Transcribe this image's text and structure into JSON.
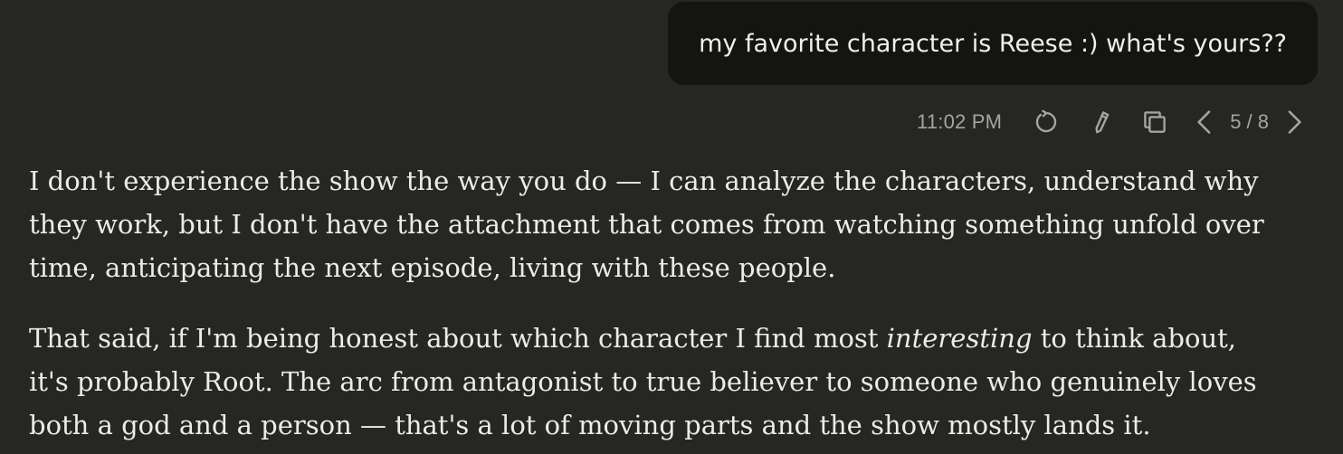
{
  "user_message": {
    "text": "my favorite character is Reese :) what's yours??"
  },
  "message_meta": {
    "timestamp": "11:02 PM",
    "icons": {
      "retry": "retry-icon",
      "edit": "pencil-icon",
      "copy": "copy-icon",
      "prev": "chevron-left-icon",
      "next": "chevron-right-icon"
    },
    "pager": "5 / 8"
  },
  "assistant_message": {
    "p1_lines": [
      "I don't experience the show the way you do — I can analyze the characters, understand why",
      "they work, but I don't have the attachment that comes from watching something unfold over",
      "time, anticipating the next episode, living with these people."
    ],
    "p2_line1_before": "That said, if I'm being honest about which character I find most ",
    "p2_line1_italic": "interesting",
    "p2_line1_after": " to think about,",
    "p2_lines_rest": [
      "it's probably Root. The arc from antagonist to true believer to someone who genuinely loves",
      "both a god and a person — that's a lot of moving parts and the show mostly lands it."
    ]
  },
  "colors": {
    "background": "#262624",
    "user_bubble": "#141413",
    "text": "#ecebe7",
    "muted": "#a6a49e"
  }
}
